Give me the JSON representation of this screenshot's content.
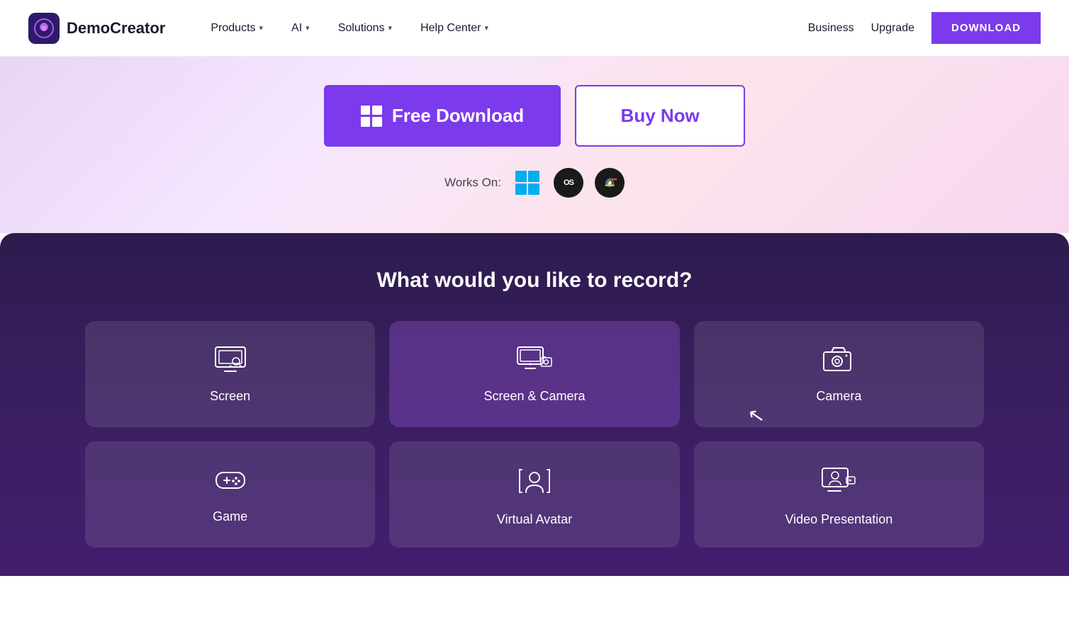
{
  "nav": {
    "logo_text": "DemoCreator",
    "items": [
      {
        "label": "Products",
        "has_dropdown": true
      },
      {
        "label": "AI",
        "has_dropdown": true
      },
      {
        "label": "Solutions",
        "has_dropdown": true
      },
      {
        "label": "Help Center",
        "has_dropdown": true
      },
      {
        "label": "Business",
        "has_dropdown": false
      },
      {
        "label": "Upgrade",
        "has_dropdown": false
      }
    ],
    "download_label": "DOWNLOAD"
  },
  "hero": {
    "free_download_label": "Free Download",
    "buy_now_label": "Buy Now",
    "works_on_label": "Works On:"
  },
  "record_section": {
    "title": "What would you like to record?",
    "cards": [
      {
        "id": "screen",
        "label": "Screen",
        "icon": "screen"
      },
      {
        "id": "screen-camera",
        "label": "Screen & Camera",
        "icon": "screen-camera",
        "highlighted": true
      },
      {
        "id": "camera",
        "label": "Camera",
        "icon": "camera"
      },
      {
        "id": "game",
        "label": "Game",
        "icon": "game"
      },
      {
        "id": "virtual-avatar",
        "label": "Virtual Avatar",
        "icon": "virtual-avatar"
      },
      {
        "id": "video-presentation",
        "label": "Video Presentation",
        "icon": "video-presentation"
      }
    ]
  },
  "colors": {
    "purple_main": "#7c3aed",
    "nav_bg": "#ffffff",
    "dark_section": "#2d1b4e"
  }
}
